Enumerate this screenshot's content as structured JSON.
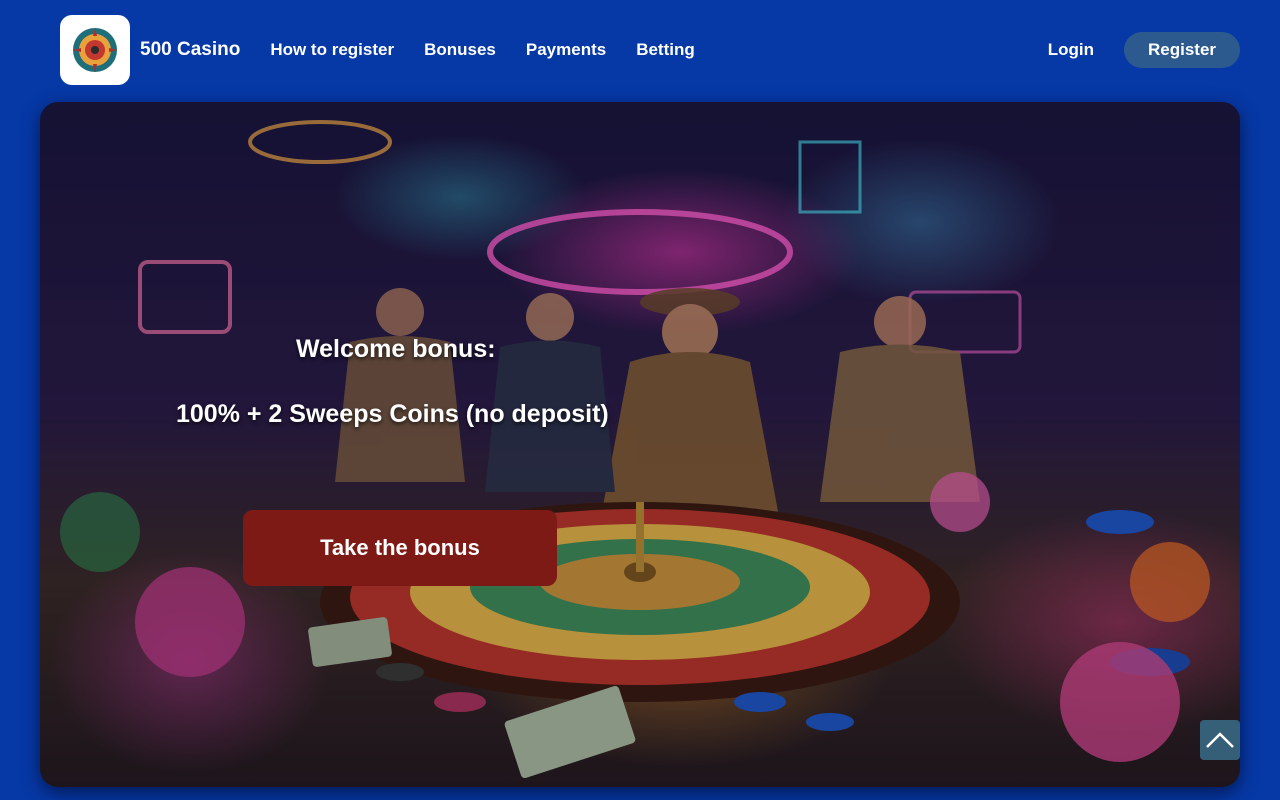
{
  "header": {
    "brand": "500 Casino",
    "logo_icon": "roulette-wheel-logo-icon",
    "nav": [
      {
        "label": "How to register"
      },
      {
        "label": "Bonuses"
      },
      {
        "label": "Payments"
      },
      {
        "label": "Betting"
      }
    ],
    "login_label": "Login",
    "register_label": "Register"
  },
  "hero": {
    "welcome_label": "Welcome bonus:",
    "offer_text": "100% + 2 Sweeps Coins (no deposit)",
    "cta_label": "Take the bonus",
    "image_description_icon": "casino-roulette-scene-image"
  },
  "scroll_top_icon": "chevron-up-icon",
  "colors": {
    "page_background": "#0638a6",
    "register_button": "#2c5a8e",
    "cta_button": "#7e1a16"
  }
}
